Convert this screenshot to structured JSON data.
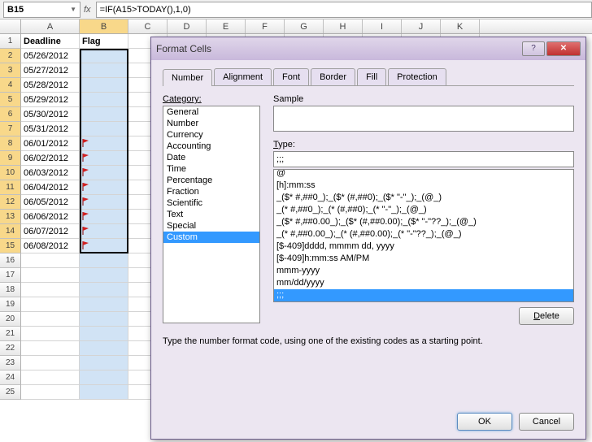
{
  "formula_bar": {
    "cell_ref": "B15",
    "fx": "fx",
    "formula": "=IF(A15>TODAY(),1,0)"
  },
  "columns": [
    "A",
    "B",
    "C",
    "D",
    "E",
    "F",
    "G",
    "H",
    "I",
    "J",
    "K"
  ],
  "headers": {
    "A": "Deadline",
    "B": "Flag"
  },
  "rows": [
    {
      "n": "1"
    },
    {
      "n": "2",
      "A": "05/26/2012",
      "flag": false
    },
    {
      "n": "3",
      "A": "05/27/2012",
      "flag": false
    },
    {
      "n": "4",
      "A": "05/28/2012",
      "flag": false
    },
    {
      "n": "5",
      "A": "05/29/2012",
      "flag": false
    },
    {
      "n": "6",
      "A": "05/30/2012",
      "flag": false
    },
    {
      "n": "7",
      "A": "05/31/2012",
      "flag": false
    },
    {
      "n": "8",
      "A": "06/01/2012",
      "flag": true
    },
    {
      "n": "9",
      "A": "06/02/2012",
      "flag": true
    },
    {
      "n": "10",
      "A": "06/03/2012",
      "flag": true
    },
    {
      "n": "11",
      "A": "06/04/2012",
      "flag": true
    },
    {
      "n": "12",
      "A": "06/05/2012",
      "flag": true
    },
    {
      "n": "13",
      "A": "06/06/2012",
      "flag": true
    },
    {
      "n": "14",
      "A": "06/07/2012",
      "flag": true
    },
    {
      "n": "15",
      "A": "06/08/2012",
      "flag": true
    },
    {
      "n": "16"
    },
    {
      "n": "17"
    },
    {
      "n": "18"
    },
    {
      "n": "19"
    },
    {
      "n": "20"
    },
    {
      "n": "21"
    },
    {
      "n": "22"
    },
    {
      "n": "23"
    },
    {
      "n": "24"
    },
    {
      "n": "25"
    }
  ],
  "selection": {
    "range": "B2:B15",
    "active": "B15"
  },
  "dialog": {
    "title": "Format Cells",
    "help_symbol": "?",
    "close_symbol": "✕",
    "tabs": [
      "Number",
      "Alignment",
      "Font",
      "Border",
      "Fill",
      "Protection"
    ],
    "active_tab": "Number",
    "category_label": "Category:",
    "categories": [
      "General",
      "Number",
      "Currency",
      "Accounting",
      "Date",
      "Time",
      "Percentage",
      "Fraction",
      "Scientific",
      "Text",
      "Special",
      "Custom"
    ],
    "selected_category": "Custom",
    "sample_label": "Sample",
    "type_label": "Type:",
    "type_value": ";;;",
    "type_options": [
      "@",
      "[h]:mm:ss",
      "_($* #,##0_);_($* (#,##0);_($* \"-\"_);_(@_)",
      "_(* #,##0_);_(* (#,##0);_(* \"-\"_);_(@_)",
      "_($* #,##0.00_);_($* (#,##0.00);_($* \"-\"??_);_(@_)",
      "_(* #,##0.00_);_(* (#,##0.00);_(* \"-\"??_);_(@_)",
      "[$-409]dddd, mmmm dd, yyyy",
      "[$-409]h:mm:ss AM/PM",
      "mmm-yyyy",
      "mm/dd/yyyy",
      ";;;"
    ],
    "selected_type": ";;;",
    "delete_label": "Delete",
    "hint": "Type the number format code, using one of the existing codes as a starting point.",
    "ok": "OK",
    "cancel": "Cancel"
  }
}
